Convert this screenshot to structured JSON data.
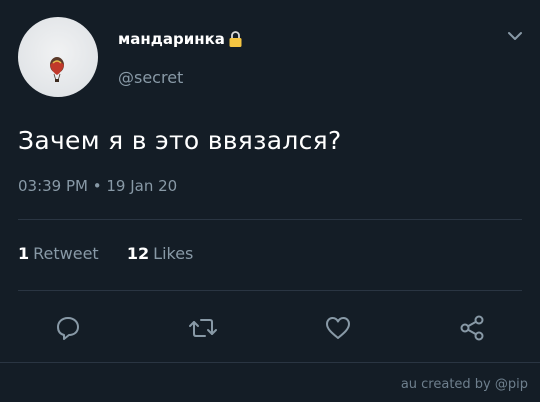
{
  "user": {
    "display_name": "мандаринка",
    "handle": "@secret"
  },
  "tweet": {
    "text": "Зачем я в это ввязался?",
    "meta": "03:39 PM • 19 Jan 20"
  },
  "stats": {
    "retweets_count": "1",
    "retweets_label": "Retweet",
    "likes_count": "12",
    "likes_label": "Likes"
  },
  "actions": {
    "icons": [
      "reply-icon",
      "retweet-icon",
      "like-icon",
      "share-icon"
    ]
  },
  "watermark": "au created by @pip",
  "colors": {
    "background": "#141d26",
    "secondary_text": "#8899a6",
    "divider": "#2a3542",
    "lock": "#f5c542"
  }
}
